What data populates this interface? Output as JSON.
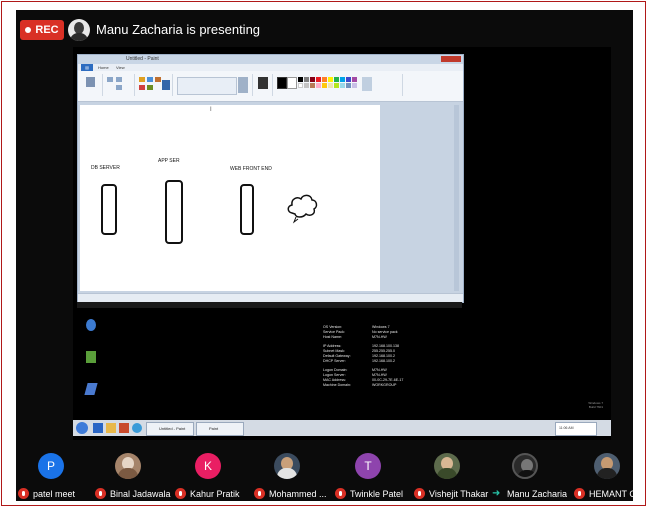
{
  "header": {
    "rec_label": "REC",
    "presenting_text": "Manu Zacharia is presenting"
  },
  "shared_screen": {
    "paint_title": "Untitled - Paint",
    "paint_tabs": [
      "Home",
      "View"
    ],
    "canvas_labels": {
      "db_server": "DB SERVER",
      "app_server": "APP SER",
      "web_front_end": "WEB FRONT END"
    },
    "sysinfo": [
      {
        "label": "OS Version:",
        "value": "Windows 7"
      },
      {
        "label": "Service Pack:",
        "value": "No service pack"
      },
      {
        "label": "Host Name:",
        "value": "M7N-HW"
      },
      {
        "label": "IP Address:",
        "value": "192.168.100.138"
      },
      {
        "label": "Subnet Mask:",
        "value": "255.255.255.0"
      },
      {
        "label": "Default Gateway:",
        "value": "192.168.100.2"
      },
      {
        "label": "DHCP Server:",
        "value": "192.168.100.2"
      },
      {
        "label": "Logon Domain:",
        "value": "M7N-HW"
      },
      {
        "label": "Logon Server:",
        "value": "M7N-HW"
      },
      {
        "label": "MAC Address:",
        "value": "00-0C-29-7E-6E-17"
      },
      {
        "label": "Machine Domain:",
        "value": "WORKGROUP"
      }
    ],
    "windows_watermark": [
      "Windows 7",
      "Build 7601"
    ],
    "taskbar_task": "Untitled - Paint",
    "taskbar_task2": "Paint",
    "clock": "11:06 AM"
  },
  "participants": [
    {
      "name": "patel meet",
      "initial": "P",
      "color": "#1a73e8",
      "muted": true
    },
    {
      "name": "Binal Jadawala",
      "initial": "",
      "color": "#9c7b64",
      "muted": true,
      "photo": true
    },
    {
      "name": "Kahur Pratik",
      "initial": "K",
      "color": "#e91e63",
      "muted": true
    },
    {
      "name": "Mohammed ...",
      "initial": "",
      "color": "#4a5b6e",
      "muted": true,
      "photo": true
    },
    {
      "name": "Twinkle Patel",
      "initial": "T",
      "color": "#8e44ad",
      "muted": true
    },
    {
      "name": "Vishejit Thakar",
      "initial": "",
      "color": "#6b7b5a",
      "muted": true,
      "photo": true
    },
    {
      "name": "Manu Zacharia",
      "initial": "",
      "color": "#3a3a3a",
      "muted": false,
      "presenting": true,
      "photo": true
    },
    {
      "name": "HEMANT GA...",
      "initial": "",
      "color": "#5a6a7c",
      "muted": true,
      "photo": true
    }
  ],
  "colors": {
    "rec_red": "#d93025",
    "present_teal": "#27c4a8",
    "frame_red": "#b01818"
  }
}
